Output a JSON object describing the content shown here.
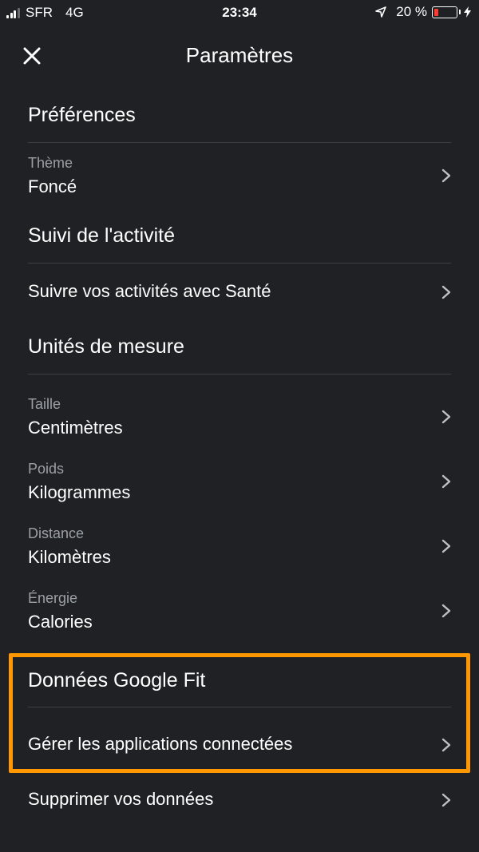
{
  "status_bar": {
    "carrier": "SFR",
    "network": "4G",
    "time": "23:34",
    "battery_text": "20 %",
    "battery_level": 0.2,
    "battery_color": "#ff3b30"
  },
  "header": {
    "title": "Paramètres",
    "close_icon": "close-icon"
  },
  "sections": {
    "preferences": {
      "title": "Préférences",
      "theme": {
        "label": "Thème",
        "value": "Foncé"
      }
    },
    "activity": {
      "title": "Suivi de l'activité",
      "health": {
        "label": "Suivre vos activités avec Santé"
      }
    },
    "units": {
      "title": "Unités de mesure",
      "height": {
        "label": "Taille",
        "value": "Centimètres"
      },
      "weight": {
        "label": "Poids",
        "value": "Kilogrammes"
      },
      "distance": {
        "label": "Distance",
        "value": "Kilomètres"
      },
      "energy": {
        "label": "Énergie",
        "value": "Calories"
      }
    },
    "google_fit": {
      "title": "Données Google Fit",
      "connected_apps": {
        "label": "Gérer les applications connectées"
      },
      "delete_data": {
        "label": "Supprimer vos données"
      }
    }
  },
  "colors": {
    "background": "#202124",
    "highlight": "#ff9800",
    "secondary_text": "#9aa0a6"
  }
}
